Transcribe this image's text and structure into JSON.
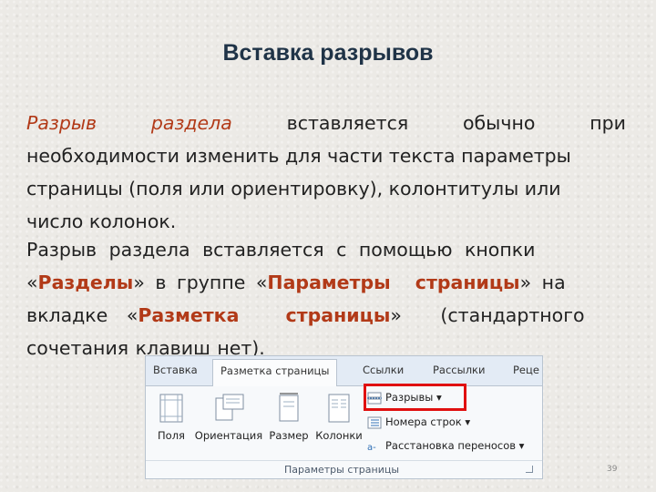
{
  "slide": {
    "title": "Вставка разрывов",
    "page_number": "39"
  },
  "paragraph1": {
    "line1": [
      "Разрыв",
      "раздела",
      "вставляется",
      "обычно",
      "при"
    ],
    "line2": "необходимости изменить для части текста параметры",
    "line3": "страницы (поля или ориентировку), колонтитулы или",
    "line4": "число колонок."
  },
  "paragraph2": {
    "l1": "Разрыв раздела вставляется с помощью кнопки",
    "l2_open": "«",
    "l2_razd": "Разделы",
    "l2_a": "» в группе «",
    "l2_params": "Параметры страницы",
    "l2_b": "» на",
    "l3_a": "вкладке «",
    "l3_razm": "Разметка страницы",
    "l3_b": "» (стандартного",
    "l4": "сочетания клавиш нет)."
  },
  "ribbon": {
    "tabs": [
      "Вставка",
      "Разметка страницы",
      "Ссылки",
      "Рассылки",
      "Реце"
    ],
    "active_tab": "Разметка страницы",
    "big_buttons": [
      "Поля",
      "Ориентация",
      "Размер",
      "Колонки"
    ],
    "small_buttons": {
      "breaks": "Разрывы ▾",
      "line_numbers": "Номера строк ▾",
      "hyphenation": "Расстановка переносов ▾"
    },
    "group_label": "Параметры страницы",
    "highlight_color": "#e01010"
  }
}
